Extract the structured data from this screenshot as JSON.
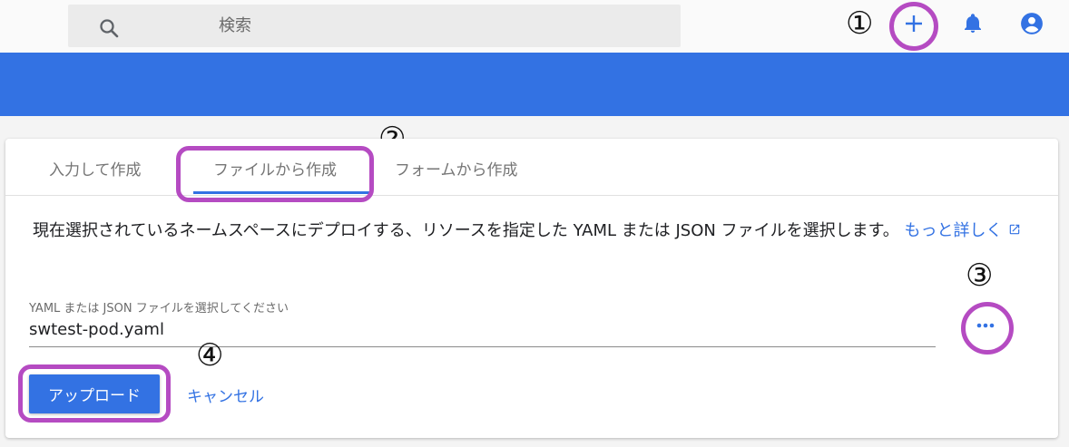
{
  "header": {
    "search_placeholder": "検索",
    "icons": {
      "search": "search-icon",
      "create": "plus-icon",
      "notifications": "bell-icon",
      "account": "account-circle-icon"
    }
  },
  "annotations": {
    "m1": "①",
    "m2": "②",
    "m3": "③",
    "m4": "④"
  },
  "tabs": [
    {
      "label": "入力して作成"
    },
    {
      "label": "ファイルから作成"
    },
    {
      "label": "フォームから作成"
    }
  ],
  "main": {
    "description": "現在選択されているネームスペースにデプロイする、リソースを指定した YAML または JSON ファイルを選択します。",
    "learn_more": "もっと詳しく",
    "file_field_label": "YAML または JSON ファイルを選択してください",
    "file_field_value": "swtest-pod.yaml",
    "upload_label": "アップロード",
    "cancel_label": "キャンセル"
  },
  "colors": {
    "accent": "#3372e3",
    "annotation": "#b54bc2"
  }
}
